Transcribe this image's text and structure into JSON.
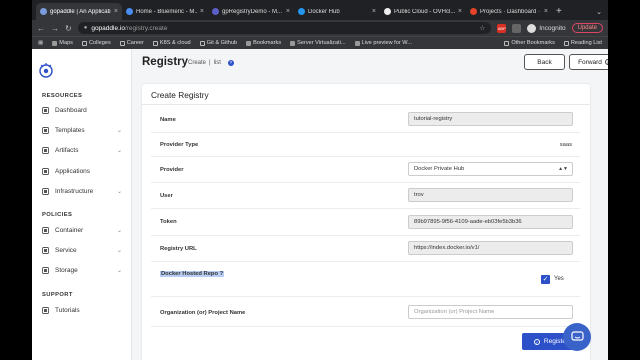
{
  "browser": {
    "tabs": [
      {
        "title": "gopaddle | An Applicati...",
        "color": "#7b9de0",
        "active": true
      },
      {
        "title": "Home - Bluemeric - M...",
        "color": "#4a8df0",
        "active": false
      },
      {
        "title": "gpRegistryDemo - M...",
        "color": "#5b5fc7",
        "active": false
      },
      {
        "title": "Docker Hub",
        "color": "#2496ed",
        "active": false
      },
      {
        "title": "Public Cloud - OVHcl...",
        "color": "#eeeeee",
        "active": false
      },
      {
        "title": "Projects · Dashboard ·",
        "color": "#e24329",
        "active": false
      }
    ],
    "url_host": "gopaddle.io",
    "url_path": "/registry.create",
    "profile_label": "Incognito",
    "update_label": "Update",
    "bookmarks": [
      "Maps",
      "Colleges",
      "Career",
      "K8S & cloud",
      "Git & Github",
      "Bookmarks",
      "Server Virtualizati...",
      "Live preview for W..."
    ],
    "bookmarks_right": [
      "Other Bookmarks",
      "Reading List"
    ]
  },
  "sidebar": {
    "resources_title": "RESOURCES",
    "resources": [
      {
        "label": "Dashboard",
        "caret": false
      },
      {
        "label": "Templates",
        "caret": true
      },
      {
        "label": "Artifacts",
        "caret": true
      },
      {
        "label": "Applications",
        "caret": false
      },
      {
        "label": "Infrastructure",
        "caret": true
      }
    ],
    "policies_title": "POLICIES",
    "policies": [
      {
        "label": "Container",
        "caret": true
      },
      {
        "label": "Service",
        "caret": true
      },
      {
        "label": "Storage",
        "caret": true
      }
    ],
    "support_title": "SUPPORT",
    "support": [
      {
        "label": "Tutorials",
        "caret": false
      }
    ]
  },
  "header": {
    "title": "Registry",
    "crumb_create": "Create",
    "crumb_sep": "|",
    "crumb_list": "list",
    "help": "?",
    "back_label": "Back",
    "forward_label": "Forward",
    "forward_info": "i"
  },
  "form": {
    "title": "Create Registry",
    "name_label": "Name",
    "name_value": "tutorial-registry",
    "provider_type_label": "Provider Type",
    "provider_type_value": "saas",
    "provider_label": "Provider",
    "provider_value": "Docker Private Hub",
    "user_label": "User",
    "user_value": "trov",
    "token_label": "Token",
    "token_value": "89b97895-9f56-4109-aade-eb03fe5b3b36",
    "registry_url_label": "Registry URL",
    "registry_url_value": "https://index.docker.io/v1/",
    "hosted_repo_label": "Docker Hosted Repo ?",
    "hosted_repo_checked": true,
    "hosted_repo_option": "Yes",
    "org_label": "Organization (or) Project Name",
    "org_placeholder": "Organization (or) Project Name",
    "register_label": "Register"
  },
  "colors": {
    "accent": "#2b50c8",
    "chrome_dark": "#202124",
    "chrome_toolbar": "#35363a"
  }
}
